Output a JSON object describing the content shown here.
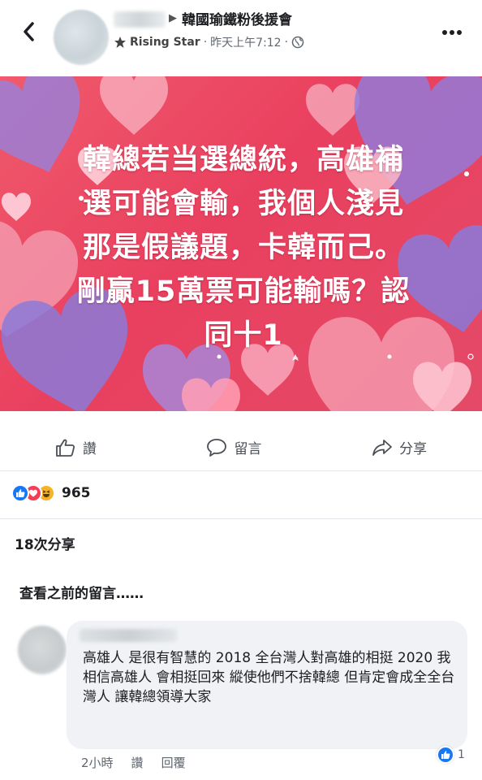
{
  "header": {
    "group_name": "韓國瑜鐵粉後援會",
    "separator": "▶",
    "badge": "Rising Star",
    "timestamp": "昨天上午7:12",
    "dot": "·"
  },
  "post": {
    "image_text_lines": [
      "韓總若当選總統，高雄補",
      "選可能會輸，我個人淺見",
      "那是假議題，卡韓而己。",
      "剛贏15萬票可能輸嗎？認",
      "同十1"
    ]
  },
  "actions": {
    "like_label": "讚",
    "comment_label": "留言",
    "share_label": "分享"
  },
  "reactions": {
    "count": "965"
  },
  "shares": {
    "label": "18次分享"
  },
  "comments": {
    "view_previous": "查看之前的留言……",
    "items": [
      {
        "text": "高雄人 是很有智慧的 2018 全台灣人對高雄的相挺 2020 我相信高雄人 會相挺回來 縱使他們不捨韓總 但肯定會成全全台灣人 讓韓總領導大家",
        "time": "2小時",
        "like_label": "讚",
        "reply_label": "回覆",
        "like_count": "1"
      }
    ]
  },
  "colors": {
    "image_bg": "#e9405f",
    "like_blue": "#1877f2",
    "love_red": "#f33e58",
    "haha_yellow": "#f7b125"
  }
}
